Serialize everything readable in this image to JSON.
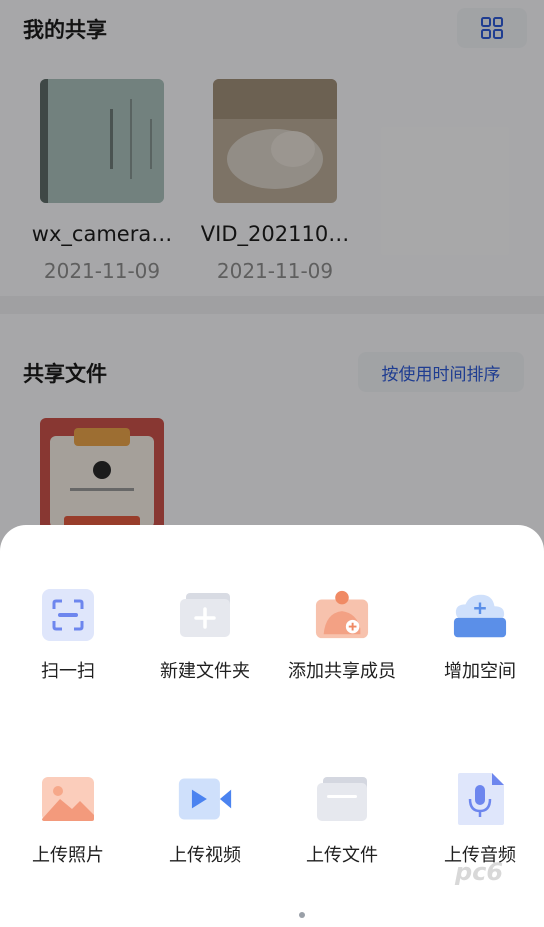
{
  "my_share": {
    "title": "我的共享",
    "files": [
      {
        "name": "wx_camera…",
        "date": "2021-11-09"
      },
      {
        "name": "VID_202110…",
        "date": "2021-11-09"
      }
    ]
  },
  "shared_files": {
    "title": "共享文件",
    "sort_label": "按使用时间排序"
  },
  "sheet": {
    "actions_row1": [
      {
        "label": "扫一扫",
        "icon": "scan-icon"
      },
      {
        "label": "新建文件夹",
        "icon": "new-folder-icon"
      },
      {
        "label": "添加共享成员",
        "icon": "add-member-icon"
      },
      {
        "label": "增加空间",
        "icon": "cloud-add-icon"
      }
    ],
    "actions_row2": [
      {
        "label": "上传照片",
        "icon": "photo-icon"
      },
      {
        "label": "上传视频",
        "icon": "video-icon"
      },
      {
        "label": "上传文件",
        "icon": "file-folder-icon"
      },
      {
        "label": "上传音频",
        "icon": "audio-icon"
      }
    ]
  },
  "colors": {
    "accent": "#2f5bd6",
    "scan": "#6d86ee",
    "folder": "#c9ccd6",
    "member": "#f19474",
    "cloud": "#5b8fe8",
    "photo": "#f39a7c",
    "video": "#4b83f0"
  },
  "watermark": "pc6"
}
